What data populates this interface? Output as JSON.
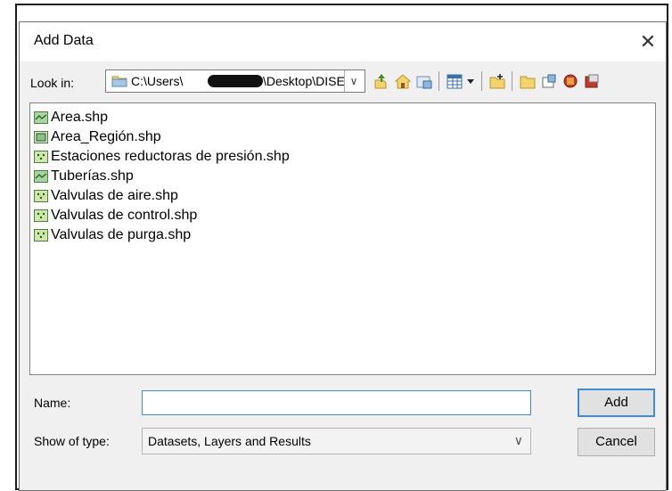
{
  "dialog": {
    "title": "Add Data",
    "close_glyph": "✕"
  },
  "look_in": {
    "label": "Look in:",
    "path_start": "C:\\Users\\",
    "path_end": "\\Desktop\\DISE",
    "arrow_glyph": "∨"
  },
  "toolbar": {
    "icons": [
      "up-one-level-icon",
      "go-home-icon",
      "connect-folder-icon",
      "view-menu-icon",
      "new-folder-icon",
      "folder-icon",
      "database-icon",
      "toolbox-icon",
      "catalog-icon"
    ]
  },
  "files": [
    {
      "name": "Area.shp",
      "icon": "polyline-shapefile-icon"
    },
    {
      "name": "Area_Región.shp",
      "icon": "polygon-shapefile-icon"
    },
    {
      "name": "Estaciones reductoras de presión.shp",
      "icon": "point-shapefile-icon"
    },
    {
      "name": "Tuberías.shp",
      "icon": "polyline-shapefile-icon"
    },
    {
      "name": "Valvulas de aire.shp",
      "icon": "point-shapefile-icon"
    },
    {
      "name": "Valvulas de control.shp",
      "icon": "point-shapefile-icon"
    },
    {
      "name": "Valvulas de purga.shp",
      "icon": "point-shapefile-icon"
    }
  ],
  "name_field": {
    "label": "Name:",
    "value": ""
  },
  "type_field": {
    "label": "Show of type:",
    "value": "Datasets, Layers and Results",
    "arrow_glyph": "∨"
  },
  "buttons": {
    "add": "Add",
    "cancel": "Cancel"
  },
  "colors": {
    "focus_border": "#3c8ed8",
    "point_shp": "#cde8a8",
    "line_shp": "#a6d6a0"
  }
}
